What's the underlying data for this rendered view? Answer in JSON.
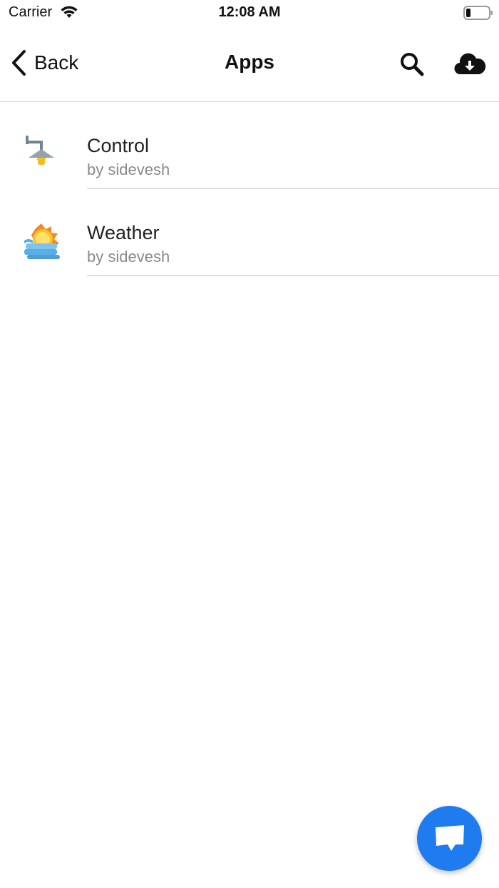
{
  "status_bar": {
    "carrier": "Carrier",
    "time": "12:08 AM",
    "wifi_icon": "wifi-icon",
    "battery_icon": "battery-icon"
  },
  "nav": {
    "back_label": "Back",
    "title": "Apps",
    "back_icon": "chevron-left-icon",
    "search_icon": "search-icon",
    "download_icon": "cloud-download-icon"
  },
  "apps": [
    {
      "name": "Control",
      "author": "by sidevesh",
      "icon": "lamp-icon"
    },
    {
      "name": "Weather",
      "author": "by sidevesh",
      "icon": "sun-weather-icon"
    }
  ],
  "fab": {
    "icon": "chat-icon"
  },
  "colors": {
    "accent": "#1e7bf0",
    "secondary_text": "#8a8a8a",
    "divider": "#dedede"
  }
}
